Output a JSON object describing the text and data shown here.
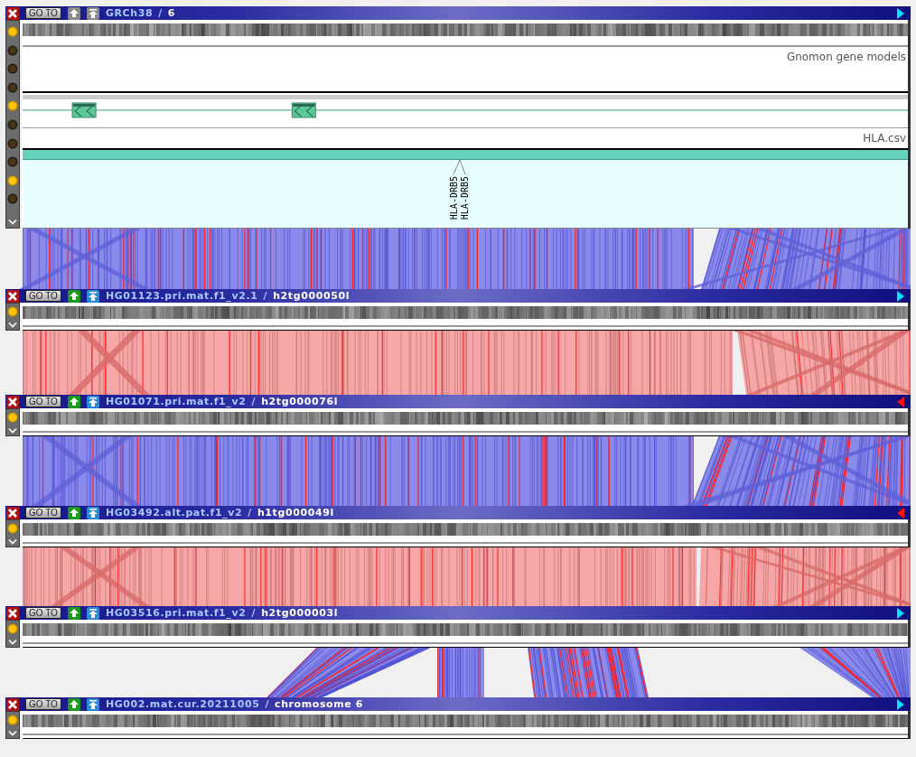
{
  "panels": [
    {
      "assembly": "GRCh38",
      "separator": "/",
      "sequence": "6",
      "reversed": false,
      "move_buttons_disabled": true,
      "goto_label": "GO TO",
      "toggles": [
        {
          "on": true
        },
        {
          "on": false
        },
        {
          "on": false
        },
        {
          "on": false
        },
        {
          "on": true
        },
        {
          "on": false
        },
        {
          "on": false
        },
        {
          "on": false
        },
        {
          "on": true
        },
        {
          "on": false
        }
      ],
      "tracks": [
        {
          "kind": "genes",
          "title": "Gnomon gene models"
        },
        {
          "kind": "features",
          "title": "HLA.csv",
          "labels": [
            "HLA-DRB5",
            "HLA-DRB5"
          ]
        }
      ]
    },
    {
      "assembly": "HG01123.pri.mat.f1_v2.1",
      "separator": "/",
      "sequence": "h2tg000050l",
      "reversed": false,
      "move_buttons_disabled": false,
      "goto_label": "GO TO",
      "toggles": [
        {
          "on": true
        }
      ]
    },
    {
      "assembly": "HG01071.pri.mat.f1_v2",
      "separator": "/",
      "sequence": "h2tg000076l",
      "reversed": true,
      "move_buttons_disabled": false,
      "goto_label": "GO TO",
      "toggles": [
        {
          "on": true
        }
      ]
    },
    {
      "assembly": "HG03492.alt.pat.f1_v2",
      "separator": "/",
      "sequence": "h1tg000049l",
      "reversed": true,
      "move_buttons_disabled": false,
      "goto_label": "GO TO",
      "toggles": [
        {
          "on": true
        }
      ]
    },
    {
      "assembly": "HG03516.pri.mat.f1_v2",
      "separator": "/",
      "sequence": "h2tg000003l",
      "reversed": false,
      "move_buttons_disabled": false,
      "goto_label": "GO TO",
      "toggles": [
        {
          "on": true
        }
      ]
    },
    {
      "assembly": "HG002.mat.cur.20211005",
      "separator": "/",
      "sequence": "chromosome 6",
      "reversed": false,
      "move_buttons_disabled": false,
      "goto_label": "GO TO",
      "toggles": [
        {
          "on": true
        }
      ]
    }
  ],
  "alignments": [
    {
      "inverted": false
    },
    {
      "inverted": true
    },
    {
      "inverted": false
    },
    {
      "inverted": true
    },
    {
      "inverted": false
    }
  ]
}
